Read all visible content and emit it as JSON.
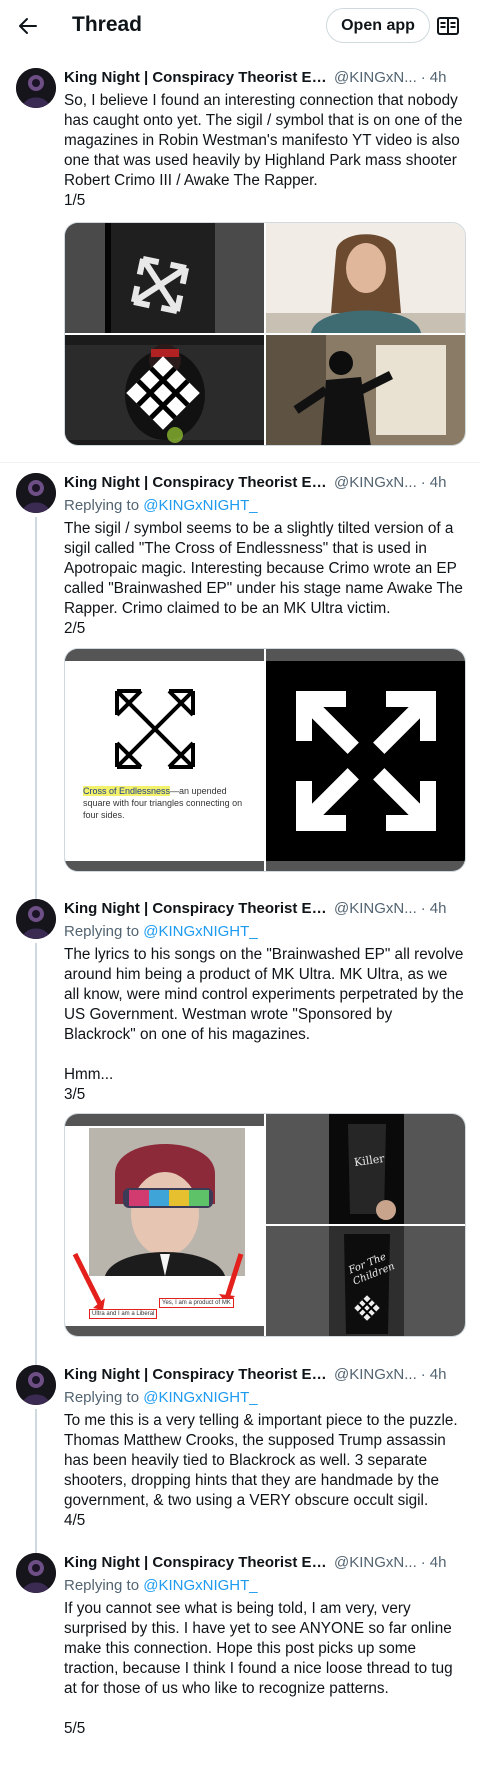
{
  "header": {
    "title": "Thread",
    "open_app_label": "Open app"
  },
  "author": {
    "name": "King Night | Conspiracy Theorist Ex...",
    "handle": "@KINGxN...",
    "time": "4h"
  },
  "replying_label": "Replying to",
  "replying_mention": "@KINGxNIGHT_",
  "posts": [
    {
      "text": "So, I believe I found an interesting connection that nobody has caught onto yet. The sigil / symbol that is on one of the magazines in Robin Westman's manifesto YT video is also one that was used heavily by Highland Park mass shooter Robert Crimo III / Awake The Rapper.\n1/5",
      "is_reply": false
    },
    {
      "text": "The sigil / symbol seems to be a slightly tilted version of a sigil called \"The Cross of Endlessness\" that is used in Apotropaic magic. Interesting because Crimo wrote an EP called \"Brainwashed EP\" under his stage name Awake The Rapper. Crimo claimed to be an MK Ultra victim.\n2/5",
      "is_reply": true,
      "media_caption_highlight": "Cross of Endlessness",
      "media_caption_rest": "—an upended square with four triangles connecting on four sides."
    },
    {
      "text": "The lyrics to his songs on the \"Brainwashed EP\" all revolve around him being a product of MK Ultra. MK Ultra, as we all know, were mind control experiments perpetrated by the US Government. Westman wrote \"Sponsored by Blackrock\" on one of his magazines.\n\nHmm...\n3/5",
      "is_reply": true,
      "media_annotations": [
        "Yes, I am a product of MK",
        "Ultra and I am a Liberal"
      ],
      "media_magazine_text": [
        "Killer",
        "For The Children"
      ]
    },
    {
      "text": "To me this is a very telling & important piece to the puzzle. Thomas Matthew Crooks, the supposed Trump assassin has been heavily tied to Blackrock as well. 3 separate shooters, dropping hints that they are handmade by the government, & two using a VERY obscure occult sigil.\n4/5",
      "is_reply": true
    },
    {
      "text": "If you cannot see what is being told, I am very, very surprised by this. I have yet to see ANYONE so far online make this connection. Hope this post picks up some traction, because I think I found a nice loose thread to tug at for those of us who like to recognize patterns.\n\n5/5",
      "is_reply": true
    }
  ],
  "icons": {
    "back": "arrow-left-icon",
    "reader": "reader-mode-icon"
  },
  "colors": {
    "link": "#1d9bf0",
    "secondary_text": "#536471",
    "border": "#cfd9de"
  }
}
